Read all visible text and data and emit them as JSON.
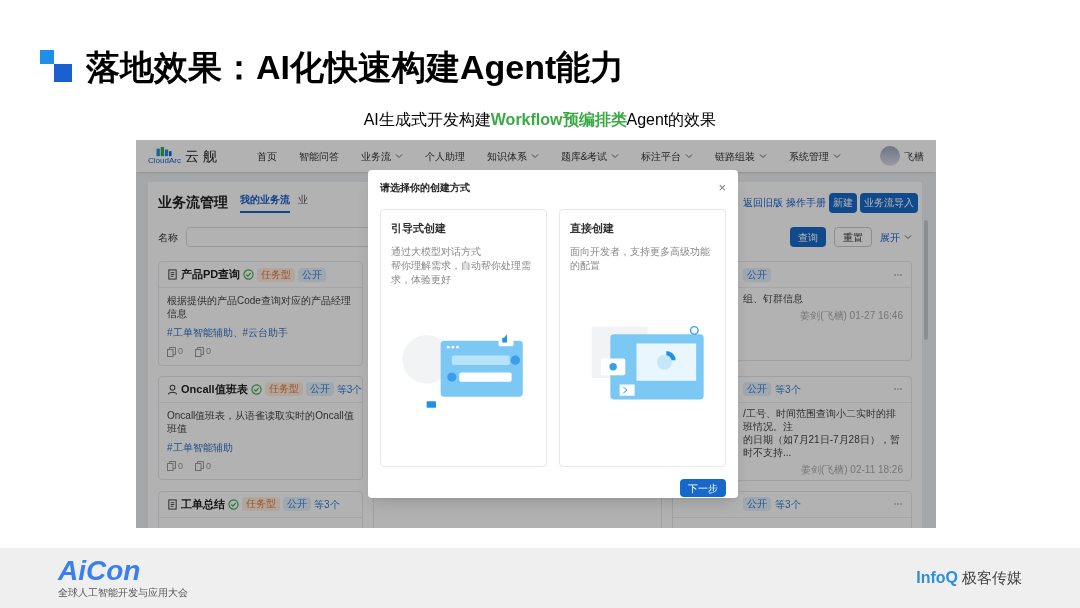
{
  "slide": {
    "title": "落地效果：AI化快速构建Agent能力",
    "subtitle": "AI生成式开发构建**Workflow预编排类**Agent的效果"
  },
  "app": {
    "brand": {
      "logo_text": "CloudArc",
      "name": "云 舰"
    },
    "nav": [
      {
        "label": "首页",
        "has_menu": false
      },
      {
        "label": "智能问答",
        "has_menu": false
      },
      {
        "label": "业务流",
        "has_menu": true
      },
      {
        "label": "个人助理",
        "has_menu": false
      },
      {
        "label": "知识体系",
        "has_menu": true
      },
      {
        "label": "题库&考试",
        "has_menu": true
      },
      {
        "label": "标注平台",
        "has_menu": true
      },
      {
        "label": "链路组装",
        "has_menu": true
      },
      {
        "label": "系统管理",
        "has_menu": true
      }
    ],
    "user": {
      "name": "飞樯"
    },
    "page_title": "业务流管理",
    "tabs": [
      {
        "label": "我的业务流",
        "selected": true
      },
      {
        "label": "业",
        "selected": false
      }
    ],
    "links": [
      "返回旧版",
      "操作手册"
    ],
    "actions": [
      "新建",
      "业务流导入"
    ],
    "filter": {
      "label": "名称",
      "buttons": [
        {
          "label": "查询",
          "kind": "primary"
        },
        {
          "label": "重置",
          "kind": "default"
        },
        {
          "label": "展开",
          "kind": "link"
        }
      ]
    },
    "cards_left": [
      {
        "kind": "doc",
        "title": "产品PD查询",
        "badges": [
          {
            "text": "任务型",
            "kind": "type"
          },
          {
            "text": "公开",
            "kind": "scope"
          }
        ],
        "desc": "根据提供的产品Code查询对应的产品经理信息",
        "tags": "#工单智能辅助、#云台助手",
        "counts": [
          "0",
          "0"
        ]
      },
      {
        "kind": "person",
        "title": "Oncall值班表",
        "badges": [
          {
            "text": "任务型",
            "kind": "type"
          },
          {
            "text": "公开",
            "kind": "scope"
          }
        ],
        "more": "等3个",
        "desc": "Oncall值班表，从语雀读取实时的Oncall值班值",
        "tags": "#工单智能辅助",
        "counts": [
          "0",
          "0"
        ]
      },
      {
        "kind": "doc",
        "title": "工单总结",
        "badges": [
          {
            "text": "任务型",
            "kind": "type"
          },
          {
            "text": "公开",
            "kind": "scope"
          }
        ],
        "more": "等3个"
      }
    ],
    "cards_right": [
      {
        "badges": [
          {
            "text": "公开",
            "kind": "scope"
          }
        ],
        "desc": [
          "组、钉群信息"
        ],
        "footer": "姜剑(飞樯) 01-27 16:46"
      },
      {
        "badges": [
          {
            "text": "公开",
            "kind": "scope"
          }
        ],
        "more": "等3个",
        "desc": [
          "/工号、时间范围查询小二实时的排班情况。注",
          "的日期（如7月21日-7月28日），暂时不支持..."
        ],
        "footer": "姜剑(飞樯) 02-11 18:26"
      },
      {
        "badges": [
          {
            "text": "公开",
            "kind": "scope"
          }
        ],
        "more": "等3个"
      }
    ]
  },
  "dialog": {
    "title": "请选择你的创建方式",
    "close": "×",
    "options": [
      {
        "title": "引导式创建",
        "lines": [
          "通过大模型对话方式",
          "帮你理解需求，自动帮你处理需求，体验更好"
        ],
        "kind": "chat"
      },
      {
        "title": "直接创建",
        "lines": [
          "面向开发者，支持更多高级功能的配置"
        ],
        "kind": "dashboard"
      }
    ],
    "next": "下一步"
  },
  "footer": {
    "left_logo": "AiCon",
    "left_caption": "全球人工智能开发与应用大会",
    "right_logo": "InfoQ",
    "right_name": "极客传媒"
  }
}
